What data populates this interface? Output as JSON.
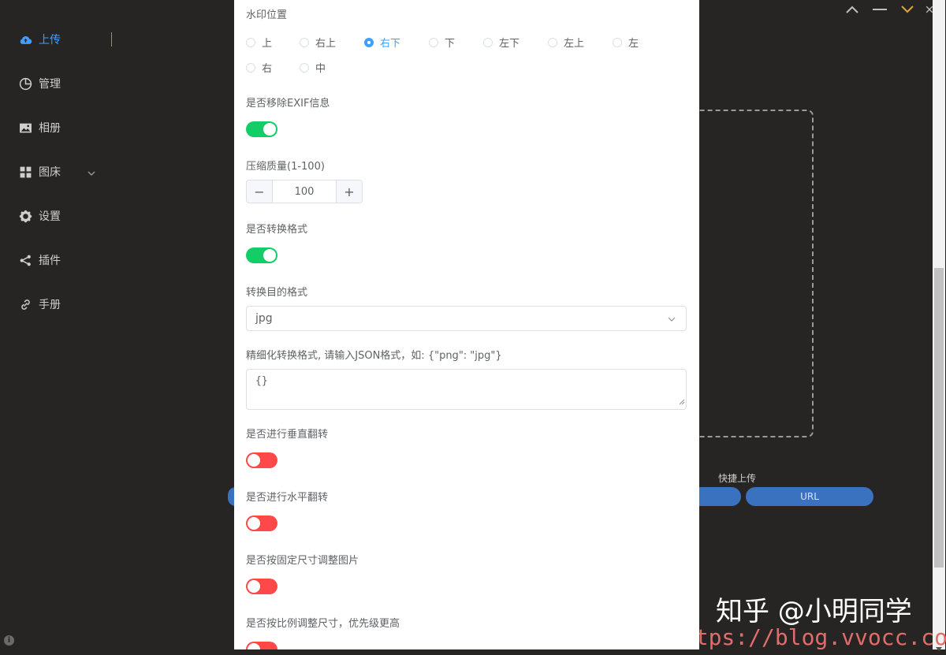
{
  "sidebar": {
    "items": [
      {
        "label": "上传",
        "icon": "cloud-upload-icon",
        "active": true
      },
      {
        "label": "管理",
        "icon": "pie-chart-icon"
      },
      {
        "label": "相册",
        "icon": "image-icon"
      },
      {
        "label": "图床",
        "icon": "grid-icon"
      },
      {
        "label": "设置",
        "icon": "gear-icon"
      },
      {
        "label": "插件",
        "icon": "share-icon"
      },
      {
        "label": "手册",
        "icon": "link-icon"
      }
    ]
  },
  "background": {
    "quick_upload_label": "快捷上传",
    "url_button": "URL"
  },
  "form": {
    "watermark_position": {
      "label": "水印位置",
      "options": [
        "上",
        "右上",
        "右下",
        "下",
        "左下",
        "左上",
        "左",
        "右",
        "中"
      ],
      "selected": "右下"
    },
    "remove_exif": {
      "label": "是否移除EXIF信息",
      "value": true
    },
    "quality": {
      "label": "压缩质量(1-100)",
      "value": "100",
      "minus": "−",
      "plus": "+"
    },
    "convert_format": {
      "label": "是否转换格式",
      "value": true
    },
    "target_format": {
      "label": "转换目的格式",
      "value": "jpg"
    },
    "fine_format": {
      "label": "精细化转换格式, 请输入JSON格式，如: {\"png\": \"jpg\"}",
      "value": "{}"
    },
    "flip_vertical": {
      "label": "是否进行垂直翻转",
      "value": false
    },
    "flip_horizontal": {
      "label": "是否进行水平翻转",
      "value": false
    },
    "fixed_resize": {
      "label": "是否按固定尺寸调整图片",
      "value": false
    },
    "ratio_resize": {
      "label": "是否按比例调整尺寸，优先级更高",
      "value": false
    }
  },
  "watermark": {
    "zhihu": "知乎 @小明同学",
    "url": "https://blog.vvocc.com"
  },
  "colors": {
    "accent": "#409eff",
    "toggle_on": "#13ce66",
    "toggle_off": "#ff4949",
    "background": "#272524"
  }
}
